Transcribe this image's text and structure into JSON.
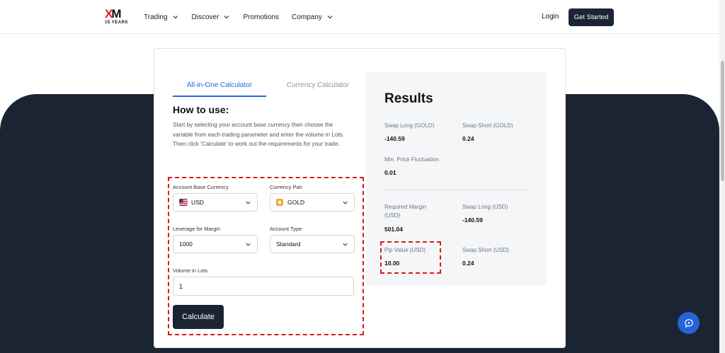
{
  "header": {
    "logo_text": "XM",
    "logo_years": "15 YEARS",
    "nav": [
      {
        "label": "Trading",
        "has_dropdown": true
      },
      {
        "label": "Discover",
        "has_dropdown": true
      },
      {
        "label": "Promotions",
        "has_dropdown": false
      },
      {
        "label": "Company",
        "has_dropdown": true
      }
    ],
    "login_label": "Login",
    "get_started_label": "Get Started"
  },
  "tabs": {
    "active": "All-in-One Calculator",
    "inactive": "Currency Calculator"
  },
  "how_to_use": {
    "title": "How to use:",
    "text": "Start by selecting your account base currency then choose the variable from each trading parameter and enter the volume in Lots. Then click 'Calculate' to work out the requirements for your trade."
  },
  "form": {
    "account_base_currency": {
      "label": "Account Base Currency",
      "value": "USD"
    },
    "currency_pair": {
      "label": "Currency Pair",
      "value": "GOLD"
    },
    "leverage": {
      "label": "Leverage for Margin",
      "value": "1000"
    },
    "account_type": {
      "label": "Account Type",
      "value": "Standard"
    },
    "volume": {
      "label": "Volume in Lots",
      "value": "1"
    },
    "calculate_label": "Calculate"
  },
  "results": {
    "title": "Results",
    "swap_long_gold": {
      "label": "Swap Long (GOLD)",
      "value": "-140.59"
    },
    "swap_short_gold": {
      "label": "Swap Short (GOLD)",
      "value": "0.24"
    },
    "min_price_fluct": {
      "label": "Min. Price Fluctuation",
      "value": "0.01"
    },
    "required_margin": {
      "label": "Required Margin (USD)",
      "value": "501.04"
    },
    "swap_long_usd": {
      "label": "Swap Long (USD)",
      "value": "-140.59"
    },
    "pip_value": {
      "label": "Pip Value (USD)",
      "value": "10.00"
    },
    "swap_short_usd": {
      "label": "Swap Short (USD)",
      "value": "0.24"
    }
  },
  "colors": {
    "accent": "#1d6fd8",
    "dark": "#1b2433",
    "highlight": "#d41c1c"
  }
}
